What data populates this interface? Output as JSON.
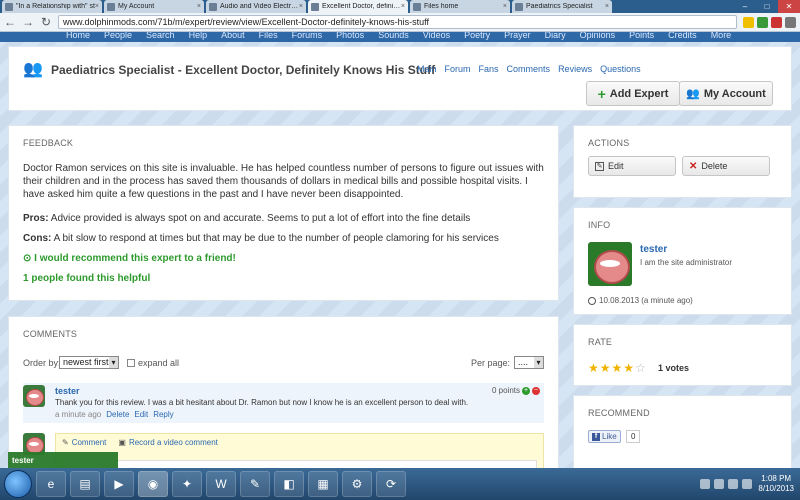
{
  "browser": {
    "tabs": [
      {
        "title": "\"In a Relationship with\" st"
      },
      {
        "title": "My Account"
      },
      {
        "title": "Audio and Video Electronic"
      },
      {
        "title": "Excellent Doctor, definitely"
      },
      {
        "title": "Files home"
      },
      {
        "title": "Paediatrics Specialist"
      }
    ],
    "url": "www.dolphinmods.com/71b/m/expert/review/view/Excellent-Doctor-definitely-knows-his-stuff"
  },
  "topnav": [
    "Home",
    "People",
    "Search",
    "Help",
    "About",
    "Files",
    "Forums",
    "Photos",
    "Sounds",
    "Videos",
    "Poetry",
    "Prayer",
    "Diary",
    "Opinions",
    "Points",
    "Credits",
    "More"
  ],
  "header": {
    "title": "Paediatrics Specialist - Excellent Doctor, Definitely Knows His Stuff",
    "subnav": [
      "Main",
      "Forum",
      "Fans",
      "Comments",
      "Reviews",
      "Questions"
    ],
    "add_expert": "Add Expert",
    "my_account": "My Account"
  },
  "feedback": {
    "heading": "FEEDBACK",
    "text": "Doctor Ramon services on this site is invaluable. He has helped countless number of persons to figure out issues with their children and in the process has saved them thousands of dollars in medical bills and possible hospital visits. I have asked him quite a few questions in the past and I have never been disappointed.",
    "pros_label": "Pros:",
    "pros": "Advice provided is always spot on and accurate. Seems to put a lot of effort into the fine details",
    "cons_label": "Cons:",
    "cons": "A bit slow to respond at times but that may be due to the number of people clamoring for his services",
    "recommend": "I would recommend this expert to a friend!",
    "helpful": "1 people found this helpful"
  },
  "comments": {
    "heading": "COMMENTS",
    "order_label": "Order by:",
    "order_value": "newest first",
    "expand_all": "expand all",
    "per_page_label": "Per page:",
    "per_page_value": "....",
    "items": [
      {
        "author": "tester",
        "points": "0 points",
        "text": "Thank you for this review. I was a bit hesitant about Dr. Ramon but now I know he is an excellent person to deal with.",
        "time": "a minute ago",
        "delete": "Delete",
        "edit": "Edit",
        "reply": "Reply"
      }
    ],
    "composer_comment": "Comment",
    "composer_video": "Record a video comment"
  },
  "actions": {
    "heading": "ACTIONS",
    "edit": "Edit",
    "delete": "Delete"
  },
  "info": {
    "heading": "INFO",
    "name": "tester",
    "desc": "I am the site administrator",
    "date": "10.08.2013 (a minute ago)"
  },
  "rate": {
    "heading": "RATE",
    "rating": 4,
    "max": 5,
    "votes": "1 votes"
  },
  "recommend": {
    "heading": "RECOMMEND",
    "like": "Like",
    "like_count": "0"
  },
  "bottom_user": "tester",
  "taskbar": {
    "time": "1:08 PM",
    "date": "8/10/2013"
  }
}
